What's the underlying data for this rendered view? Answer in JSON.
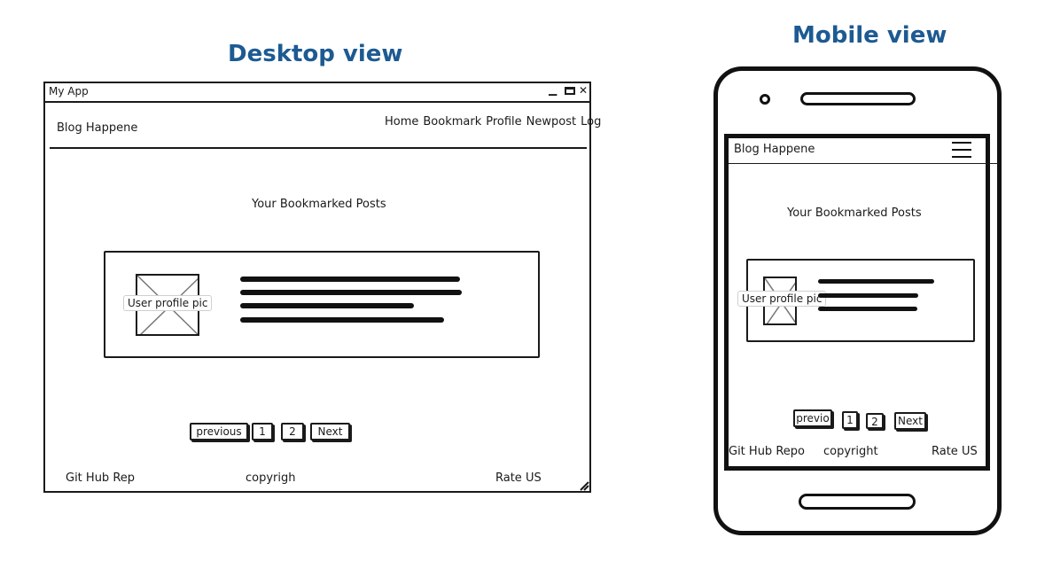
{
  "desktop": {
    "view_title": "Desktop view",
    "window_title": "My App",
    "window_controls": {
      "minimize": "▁",
      "maximize": "▭",
      "close": "✕"
    },
    "brand": "Blog Happene",
    "nav": [
      "Home",
      "Bookmark",
      "Profile",
      "Newpost",
      "Log"
    ],
    "heading": "Your Bookmarked Posts",
    "post": {
      "image_label": "User profile pic"
    },
    "pagination": {
      "previous": "previous",
      "pages": [
        "1",
        "2"
      ],
      "next": "Next"
    },
    "footer": {
      "left": "Git Hub Rep",
      "center": "copyrigh",
      "right": "Rate US"
    }
  },
  "mobile": {
    "view_title": "Mobile view",
    "brand": "Blog Happene",
    "heading": "Your Bookmarked Posts",
    "post": {
      "image_label": "User profile pic"
    },
    "pagination": {
      "previous": "previo",
      "pages": [
        "1",
        "2"
      ],
      "next": "Next"
    },
    "footer": {
      "left": "Git Hub Repo",
      "center": "copyright",
      "right": "Rate US"
    }
  },
  "colors": {
    "title": "#1d5a92",
    "ink": "#1a1a1a"
  }
}
